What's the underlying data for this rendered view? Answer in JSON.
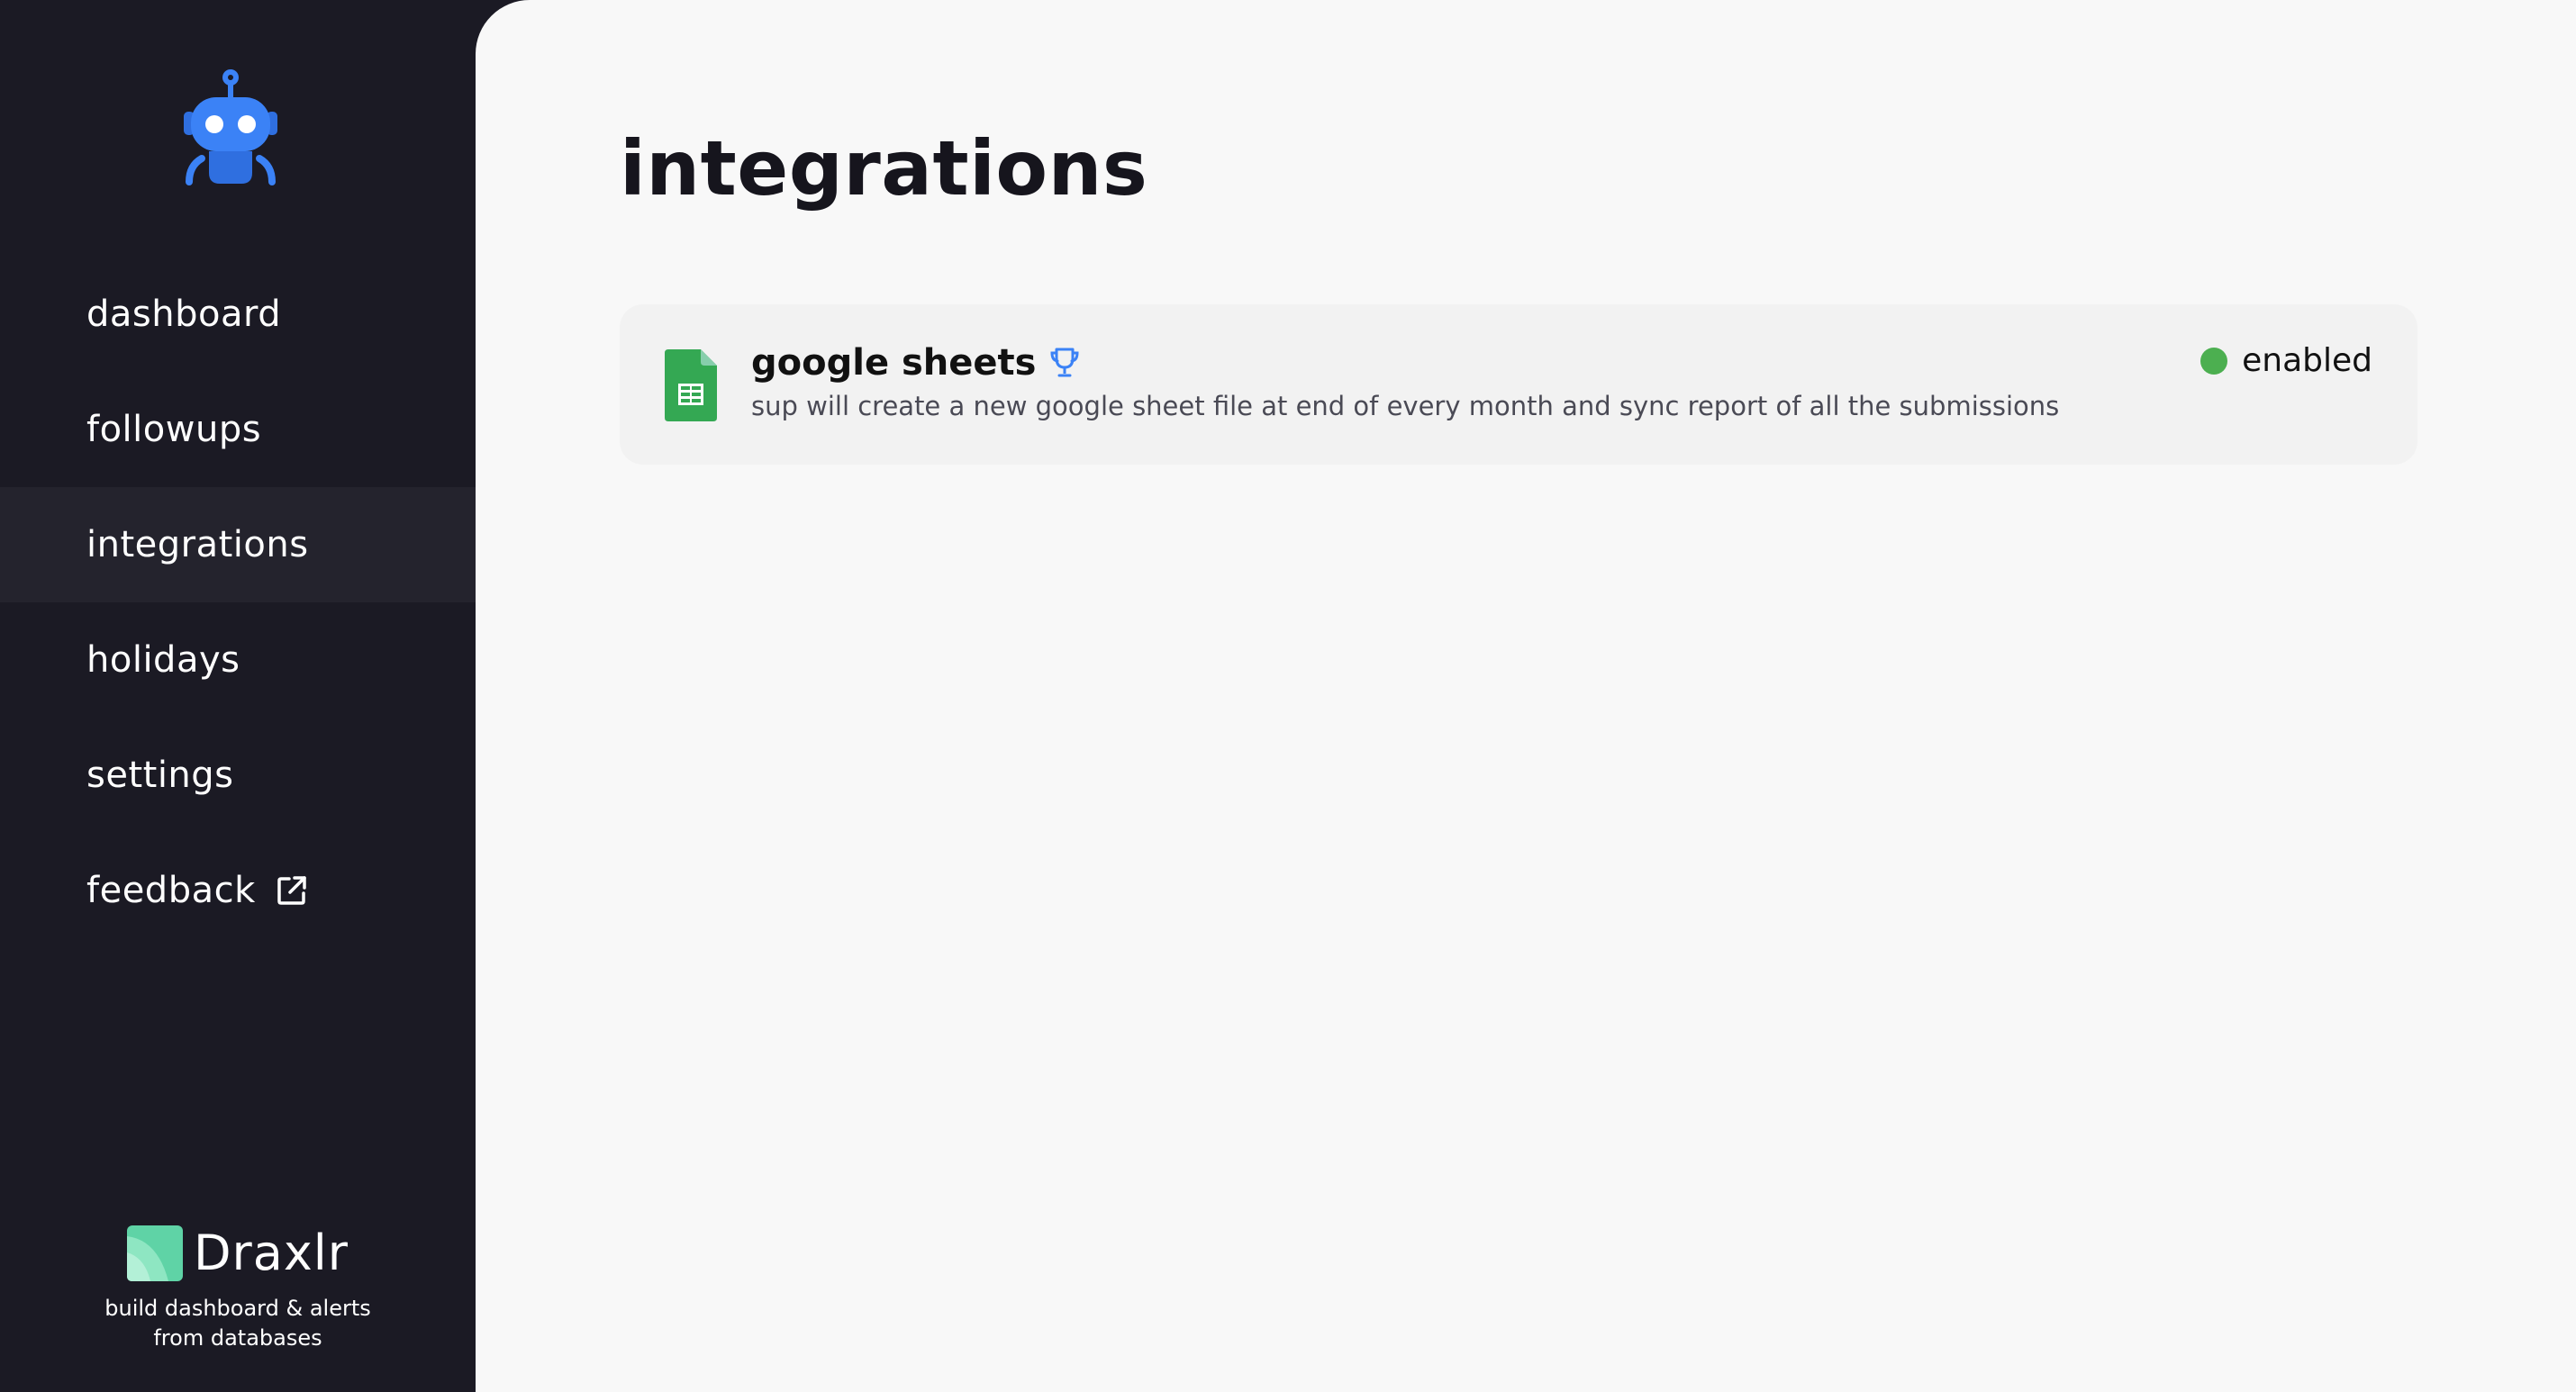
{
  "sidebar": {
    "logo_icon": "robot-icon",
    "items": [
      {
        "label": "dashboard"
      },
      {
        "label": "followups"
      },
      {
        "label": "integrations",
        "active": true
      },
      {
        "label": "holidays"
      },
      {
        "label": "settings"
      },
      {
        "label": "feedback",
        "icon": "external-link-icon"
      }
    ],
    "brand": {
      "name": "Draxlr",
      "tagline": "build dashboard & alerts from databases"
    }
  },
  "main": {
    "title": "integrations",
    "integrations": [
      {
        "icon": "google-sheets-icon",
        "name": "google sheets",
        "badge_icon": "trophy-icon",
        "description": "sup will create a new google sheet file at end of every month and sync report of all the submissions",
        "status": "enabled",
        "status_color": "#4caf50"
      }
    ]
  },
  "colors": {
    "sidebar_bg": "#1b1a24",
    "active_item_bg": "#24232d",
    "main_bg": "#f8f8f8",
    "card_bg": "#f2f2f2",
    "accent_blue": "#3b82f6"
  }
}
